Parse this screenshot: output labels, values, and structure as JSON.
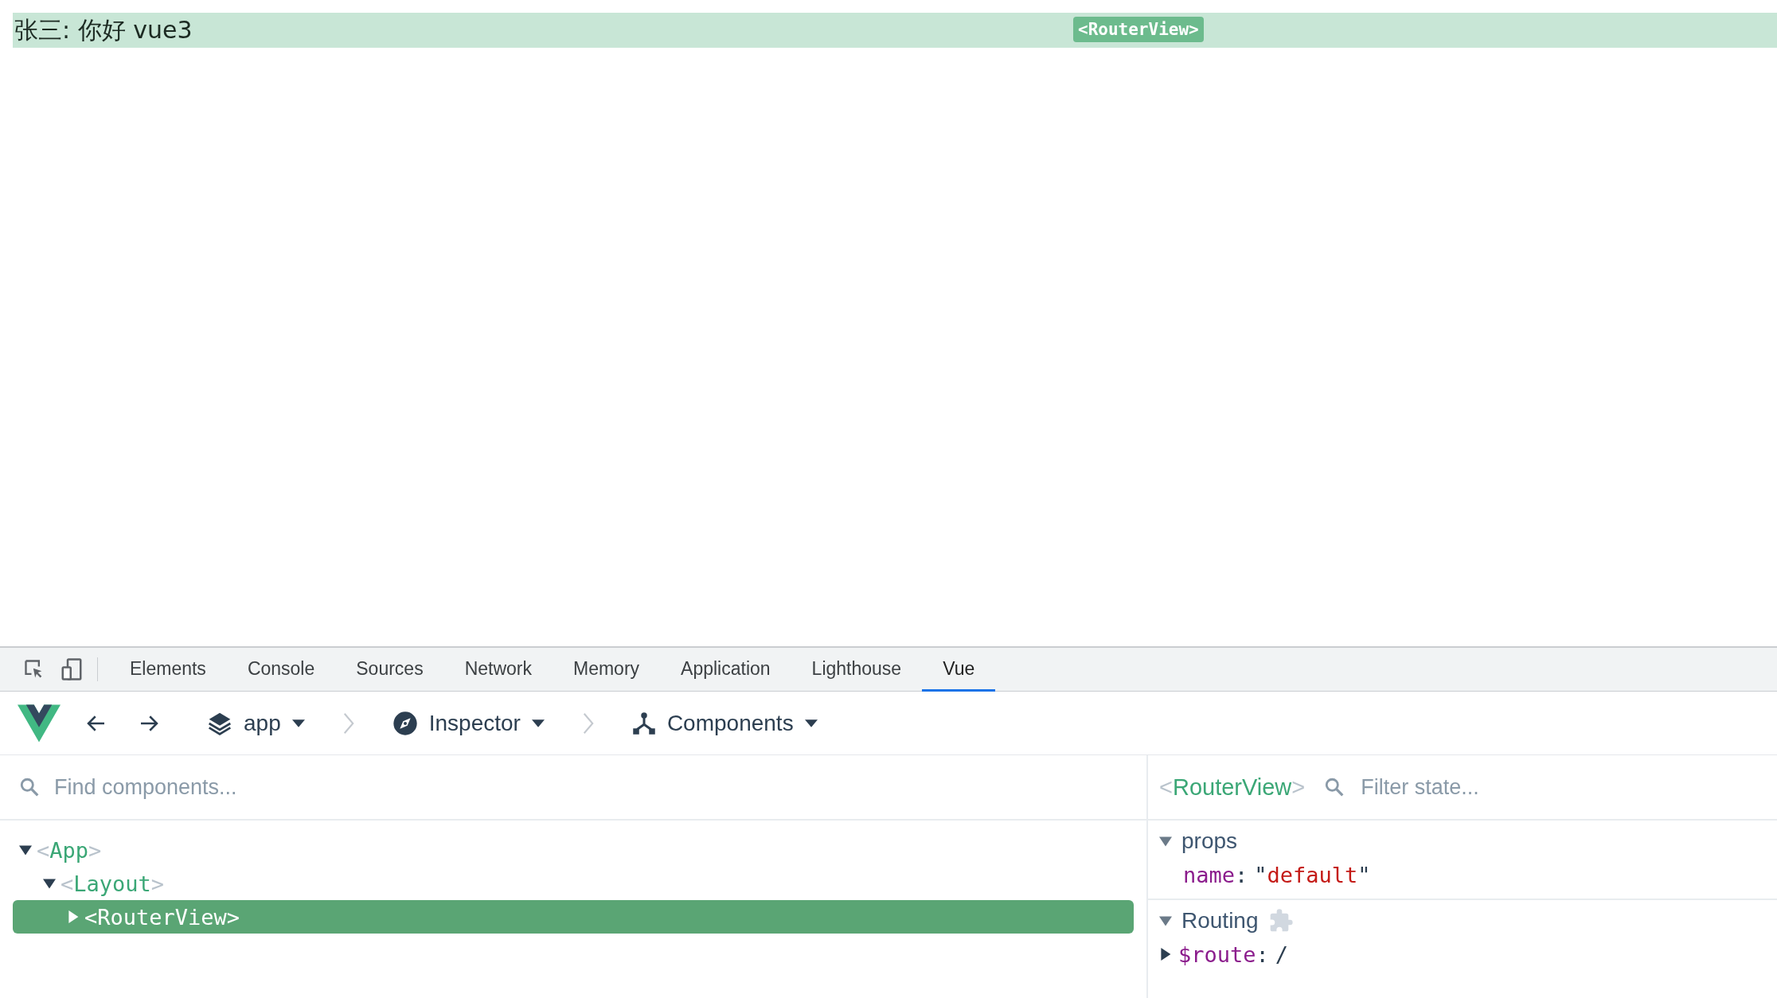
{
  "page": {
    "heading": "张三: 你好 vue3",
    "overlay_badge": "<RouterView>"
  },
  "devtools_tabs": [
    {
      "label": "Elements",
      "selected": false
    },
    {
      "label": "Console",
      "selected": false
    },
    {
      "label": "Sources",
      "selected": false
    },
    {
      "label": "Network",
      "selected": false
    },
    {
      "label": "Memory",
      "selected": false
    },
    {
      "label": "Application",
      "selected": false
    },
    {
      "label": "Lighthouse",
      "selected": false
    },
    {
      "label": "Vue",
      "selected": true
    }
  ],
  "vue_toolbar": {
    "app": "app",
    "inspector": "Inspector",
    "view": "Components"
  },
  "component_search": {
    "placeholder": "Find components..."
  },
  "component_tree": [
    {
      "label": "<App>",
      "expanded": true,
      "selected": false,
      "children": [
        {
          "label": "<Layout>",
          "expanded": true,
          "selected": false,
          "children": [
            {
              "label": "<RouterView>",
              "expanded": false,
              "selected": true
            }
          ]
        }
      ]
    }
  ],
  "inspector": {
    "component": "<RouterView>",
    "filter_placeholder": "Filter state...",
    "sections": [
      {
        "title": "props",
        "expanded": true,
        "plugin": false,
        "entries": [
          {
            "key": "name:",
            "value": "\"default\"",
            "kind": "string"
          }
        ]
      },
      {
        "title": "Routing",
        "expanded": true,
        "plugin": true,
        "entries": [
          {
            "key": "$route:",
            "value": "/",
            "kind": "object",
            "expanded": false
          }
        ]
      }
    ]
  }
}
